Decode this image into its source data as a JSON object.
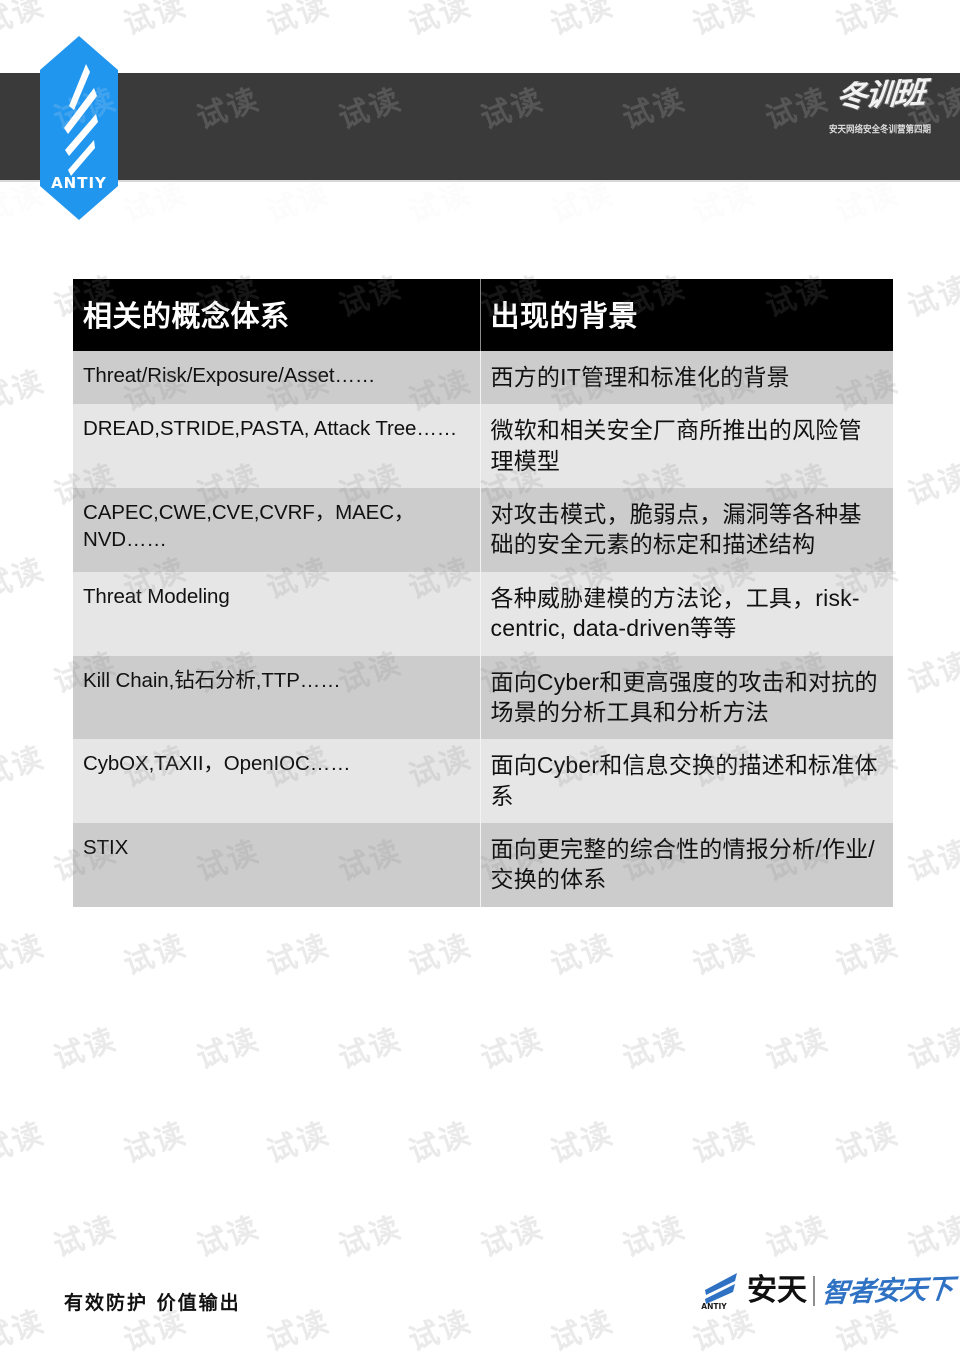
{
  "brand": {
    "logo_text": "ANTIY",
    "logo_color": "#2196ef",
    "top_band_color": "#3a3a3a"
  },
  "event_title": {
    "main": "冬训班",
    "subtitle": "安天网络安全冬训营第四期"
  },
  "table": {
    "headers": [
      "相关的概念体系",
      "出现的背景"
    ],
    "rows": [
      {
        "concept": "Threat/Risk/Exposure/Asset……",
        "context": "西方的IT管理和标准化的背景"
      },
      {
        "concept": "DREAD,STRIDE,PASTA, Attack Tree……",
        "context": "微软和相关安全厂商所推出的风险管理模型"
      },
      {
        "concept": "CAPEC,CWE,CVE,CVRF，MAEC，NVD……",
        "context": "对攻击模式，脆弱点，漏洞等各种基础的安全元素的标定和描述结构"
      },
      {
        "concept": "Threat Modeling",
        "context": "各种威胁建模的方法论，工具，risk-centric, data-driven等等"
      },
      {
        "concept": "Kill Chain,钻石分析,TTP……",
        "context": "面向Cyber和更高强度的攻击和对抗的场景的分析工具和分析方法"
      },
      {
        "concept": "CybOX,TAXII，OpenIOC……",
        "context": "面向Cyber和信息交换的描述和标准体系"
      },
      {
        "concept": "STIX",
        "context": "面向更完整的综合性的情报分析/作业/交换的体系"
      }
    ]
  },
  "footer": {
    "slogan": "有效防护 价值输出",
    "logo_name": "安天",
    "logo_tagline": "智者安天下"
  },
  "watermark": {
    "text": "试读"
  }
}
